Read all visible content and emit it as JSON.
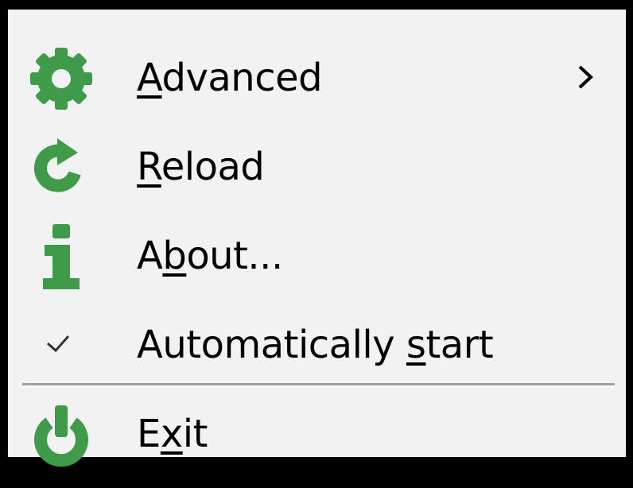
{
  "menu": {
    "items": [
      {
        "id": "advanced",
        "pre": "",
        "accel": "A",
        "post": "dvanced",
        "icon": "gear-icon",
        "has_submenu": true
      },
      {
        "id": "reload",
        "pre": "",
        "accel": "R",
        "post": "eload",
        "icon": "reload-icon",
        "has_submenu": false
      },
      {
        "id": "about",
        "pre": "A",
        "accel": "b",
        "post": "out...",
        "icon": "info-icon",
        "has_submenu": false
      },
      {
        "id": "autostart",
        "pre": "Automatically ",
        "accel": "s",
        "post": "tart",
        "icon": "checkmark-icon",
        "checked": true
      },
      {
        "id": "exit",
        "pre": "E",
        "accel": "x",
        "post": "it",
        "icon": "power-icon",
        "has_submenu": false
      }
    ]
  },
  "colors": {
    "icon_green": "#3f9a4a",
    "menu_bg": "#f2f2f2",
    "separator": "#a0a0a0"
  }
}
